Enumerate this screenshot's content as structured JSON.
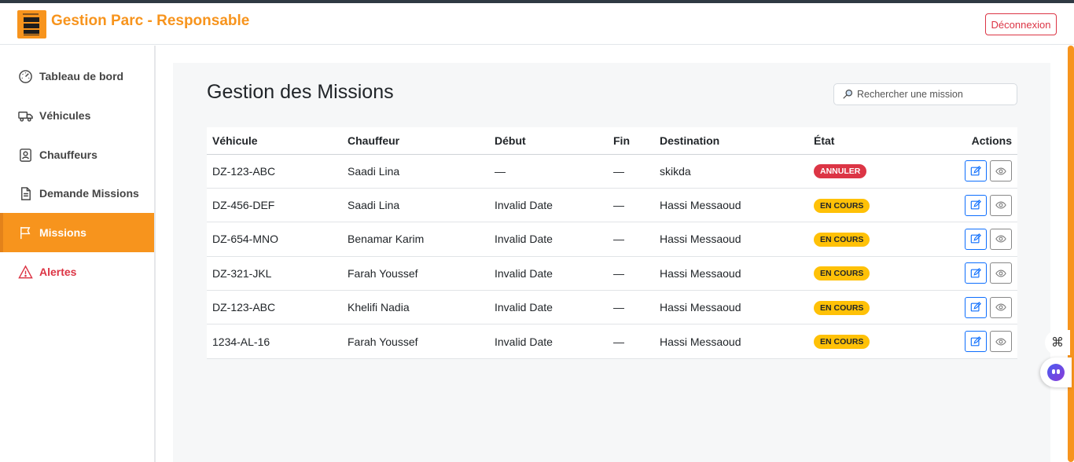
{
  "brand": {
    "title": "Gestion Parc - Responsable"
  },
  "header": {
    "logout_label": "Déconnexion"
  },
  "sidebar": {
    "items": [
      {
        "label": "Tableau de bord",
        "icon": "speedometer-icon",
        "active": false
      },
      {
        "label": "Véhicules",
        "icon": "truck-icon",
        "active": false
      },
      {
        "label": "Chauffeurs",
        "icon": "badge-person-icon",
        "active": false
      },
      {
        "label": "Demande Missions",
        "icon": "document-icon",
        "active": false
      },
      {
        "label": "Missions",
        "icon": "flag-icon",
        "active": true
      },
      {
        "label": "Alertes",
        "icon": "warning-icon",
        "active": false
      }
    ]
  },
  "main": {
    "title": "Gestion des Missions",
    "search": {
      "placeholder": "Rechercher une mission"
    },
    "table": {
      "headers": [
        "Véhicule",
        "Chauffeur",
        "Début",
        "Fin",
        "Destination",
        "État",
        "Actions"
      ],
      "rows": [
        {
          "vehicule": "DZ-123-ABC",
          "chauffeur": "Saadi Lina",
          "debut": "—",
          "fin": "—",
          "destination": "skikda",
          "etat": "ANNULER"
        },
        {
          "vehicule": "DZ-456-DEF",
          "chauffeur": "Saadi Lina",
          "debut": "Invalid Date",
          "fin": "—",
          "destination": "Hassi Messaoud",
          "etat": "EN COURS"
        },
        {
          "vehicule": "DZ-654-MNO",
          "chauffeur": "Benamar Karim",
          "debut": "Invalid Date",
          "fin": "—",
          "destination": "Hassi Messaoud",
          "etat": "EN COURS"
        },
        {
          "vehicule": "DZ-321-JKL",
          "chauffeur": "Farah Youssef",
          "debut": "Invalid Date",
          "fin": "—",
          "destination": "Hassi Messaoud",
          "etat": "EN COURS"
        },
        {
          "vehicule": "DZ-123-ABC",
          "chauffeur": "Khelifi Nadia",
          "debut": "Invalid Date",
          "fin": "—",
          "destination": "Hassi Messaoud",
          "etat": "EN COURS"
        },
        {
          "vehicule": "1234-AL-16",
          "chauffeur": "Farah Youssef",
          "debut": "Invalid Date",
          "fin": "—",
          "destination": "Hassi Messaoud",
          "etat": "EN COURS"
        }
      ]
    }
  },
  "colors": {
    "accent": "#f7941d",
    "danger": "#dc3545",
    "warning": "#ffc107",
    "primary": "#0d6efd"
  }
}
